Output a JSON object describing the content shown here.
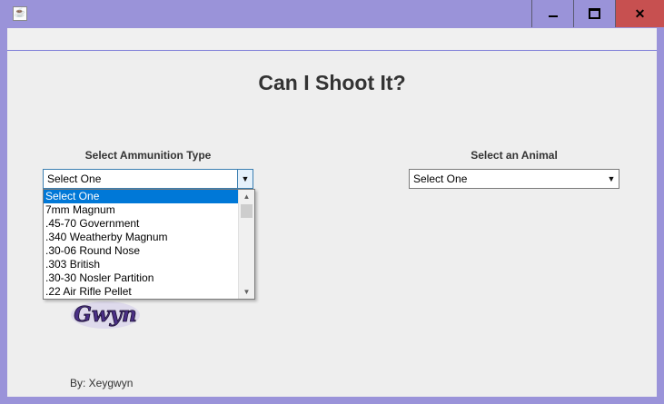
{
  "window": {
    "icon": "java-icon",
    "minimize_label": "minimize",
    "maximize_label": "maximize",
    "close_label": "close"
  },
  "main": {
    "title": "Can I Shoot It?",
    "ammo_label": "Select Ammunition Type",
    "animal_label": "Select an Animal",
    "ammo_combo_value": "Select One",
    "animal_combo_value": "Select One",
    "ammo_options": [
      "Select One",
      "7mm Magnum",
      ".45-70 Government",
      ".340 Weatherby Magnum",
      ".30-06 Round Nose",
      ".303 British",
      ".30-30 Nosler Partition",
      ".22 Air Rifle Pellet"
    ],
    "selected_option_index": 0,
    "logo_text": "Gwyn",
    "author": "By: Xeygwyn"
  },
  "colors": {
    "frame": "#9a93d9",
    "close_button": "#c75050",
    "selection": "#0078d7",
    "content_bg": "#eeeeee"
  }
}
